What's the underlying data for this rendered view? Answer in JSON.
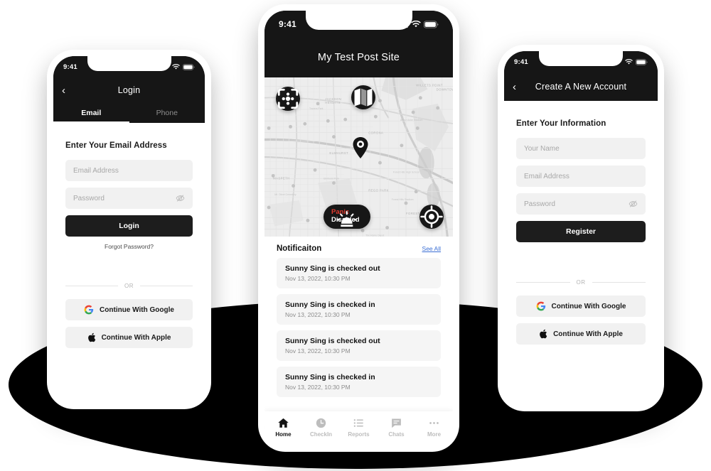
{
  "scene": {
    "background": "#ffffff",
    "shadow_color": "#000000"
  },
  "login_phone": {
    "status": {
      "time": "9:41",
      "wifi": "wifi-icon",
      "battery": "battery-icon"
    },
    "header": {
      "back": "‹",
      "title": "Login"
    },
    "tabs": [
      {
        "label": "Email",
        "active": true
      },
      {
        "label": "Phone",
        "active": false
      }
    ],
    "section_title": "Enter Your Email Address",
    "fields": [
      {
        "name": "email",
        "placeholder": "Email Address",
        "value": ""
      },
      {
        "name": "password",
        "placeholder": "Password",
        "value": "",
        "toggle": "eye-slash-icon"
      }
    ],
    "primary_button": "Login",
    "forgot_label": "Forgot Password?",
    "divider_label": "OR",
    "social": [
      {
        "provider": "google",
        "label": "Continue With Google"
      },
      {
        "provider": "apple",
        "label": "Continue With Apple"
      }
    ]
  },
  "home_phone": {
    "status": {
      "time": "9:41",
      "signal": "signal-icon",
      "wifi": "wifi-icon",
      "battery": "battery-icon"
    },
    "header": {
      "title": "My Test Post Site"
    },
    "map": {
      "scan_button": "scan-icon",
      "maps_button": "map-folded-icon",
      "locate_button": "locate-icon",
      "pin": "map-pin-icon",
      "panic": {
        "icon": "siren-icon",
        "line1": "Panic",
        "line2": "Disabled",
        "line1_color": "#e03b2f",
        "line2_color": "#ffffff"
      },
      "labels": [
        "WILLETS POINT",
        "DOWNTOWN FLUSHING",
        "JACKSON HEIGHTS",
        "CORONA",
        "ELMHURST",
        "MASPETH",
        "REGO PARK",
        "FOREST HILLS",
        "Travers Park",
        "Flushing Meadows",
        "Juniper Valley Park",
        "Forest Hills Stadium",
        "Mt. Olivet Cemetery",
        "The Home Depot"
      ]
    },
    "notifications": {
      "title": "Notificaiton",
      "see_all": "See All",
      "items": [
        {
          "text": "Sunny Sing is checked out",
          "time": "Nov 13, 2022, 10:30 PM"
        },
        {
          "text": "Sunny Sing is checked in",
          "time": "Nov 13, 2022, 10:30 PM"
        },
        {
          "text": "Sunny Sing is checked out",
          "time": "Nov 13, 2022, 10:30 PM"
        },
        {
          "text": "Sunny Sing is checked in",
          "time": "Nov 13, 2022, 10:30 PM"
        }
      ]
    },
    "tabbar": [
      {
        "label": "Home",
        "icon": "home-icon",
        "active": true
      },
      {
        "label": "CheckIn",
        "icon": "clock-icon",
        "active": false
      },
      {
        "label": "Reports",
        "icon": "list-icon",
        "active": false
      },
      {
        "label": "Chats",
        "icon": "chat-icon",
        "active": false
      },
      {
        "label": "More",
        "icon": "ellipsis-icon",
        "active": false
      }
    ]
  },
  "register_phone": {
    "status": {
      "time": "9:41",
      "wifi": "wifi-icon",
      "battery": "battery-icon"
    },
    "header": {
      "back": "‹",
      "title": "Create A New Account"
    },
    "section_title": "Enter Your Information",
    "fields": [
      {
        "name": "name",
        "placeholder": "Your Name",
        "value": ""
      },
      {
        "name": "email",
        "placeholder": "Email Address",
        "value": ""
      },
      {
        "name": "password",
        "placeholder": "Password",
        "value": "",
        "toggle": "eye-slash-icon"
      }
    ],
    "primary_button": "Register",
    "divider_label": "OR",
    "social": [
      {
        "provider": "google",
        "label": "Continue With Google"
      },
      {
        "provider": "apple",
        "label": "Continue With Apple"
      }
    ]
  }
}
